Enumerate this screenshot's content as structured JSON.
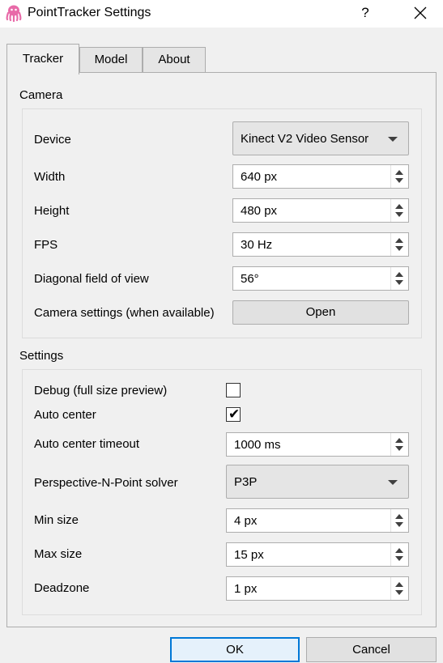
{
  "window": {
    "title": "PointTracker Settings",
    "help_label": "?",
    "icon": "octopus-icon",
    "accent_color": "#0078d7"
  },
  "tabs": [
    {
      "label": "Tracker",
      "active": true
    },
    {
      "label": "Model",
      "active": false
    },
    {
      "label": "About",
      "active": false
    }
  ],
  "camera": {
    "title": "Camera",
    "device": {
      "label": "Device",
      "value": "Kinect V2 Video Sensor"
    },
    "width": {
      "label": "Width",
      "value": "640 px"
    },
    "height": {
      "label": "Height",
      "value": "480 px"
    },
    "fps": {
      "label": "FPS",
      "value": "30 Hz"
    },
    "fov": {
      "label": "Diagonal field of view",
      "value": "56°"
    },
    "camera_settings": {
      "label": "Camera settings (when available)",
      "button": "Open"
    }
  },
  "settings": {
    "title": "Settings",
    "debug": {
      "label": "Debug (full size preview)",
      "checked": false
    },
    "auto_center": {
      "label": "Auto center",
      "checked": true,
      "mark": "✔"
    },
    "auto_center_timeout": {
      "label": "Auto center timeout",
      "value": "1000 ms"
    },
    "pnp_solver": {
      "label": "Perspective-N-Point solver",
      "value": "P3P"
    },
    "min_size": {
      "label": "Min size",
      "value": "4 px"
    },
    "max_size": {
      "label": "Max size",
      "value": "15 px"
    },
    "deadzone": {
      "label": "Deadzone",
      "value": "1 px"
    }
  },
  "footer": {
    "ok_label": "OK",
    "cancel_label": "Cancel"
  }
}
